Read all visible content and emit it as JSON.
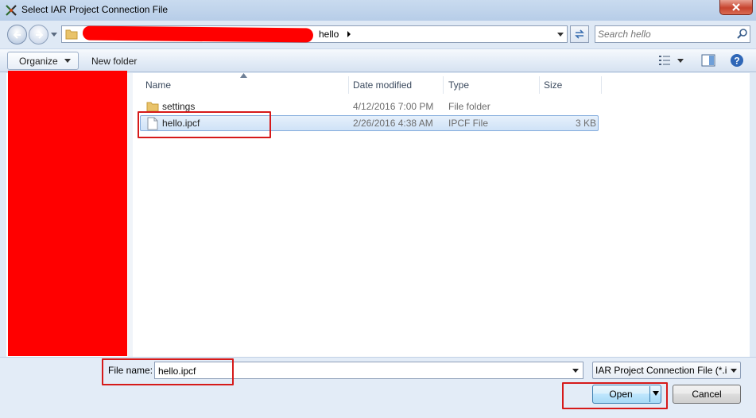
{
  "window": {
    "title": "Select IAR Project Connection File",
    "close_icon": "close-x-icon"
  },
  "address": {
    "current_folder": "hello",
    "search_placeholder": "Search hello"
  },
  "toolbar": {
    "organize_label": "Organize",
    "new_folder_label": "New folder"
  },
  "columns": {
    "name": "Name",
    "date_modified": "Date modified",
    "type": "Type",
    "size": "Size"
  },
  "files": [
    {
      "name": "settings",
      "date_modified": "4/12/2016 7:00 PM",
      "type": "File folder",
      "size": "",
      "icon": "folder-icon",
      "selected": false
    },
    {
      "name": "hello.ipcf",
      "date_modified": "2/26/2016 4:38 AM",
      "type": "IPCF File",
      "size": "3 KB",
      "icon": "file-icon",
      "selected": true
    }
  ],
  "file_name": {
    "label": "File name:",
    "value": "hello.ipcf"
  },
  "file_type_filter": {
    "selected": "IAR Project Connection File (*.ipcf)"
  },
  "buttons": {
    "open_label": "Open",
    "cancel_label": "Cancel"
  },
  "colors": {
    "highlight_box": "#d61a1a",
    "redaction": "#ff0000",
    "selection": "#cfe2f7"
  }
}
